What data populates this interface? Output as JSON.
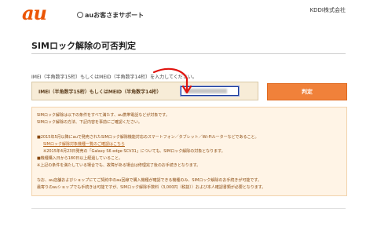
{
  "header": {
    "logo_text": "au",
    "support_label": "auお客さまサポート",
    "company": "KDDI株式会社"
  },
  "page_title": "SIMロック解除の可否判定",
  "form": {
    "hint": "IMEI（半角数字15桁）もしくはMEID（半角数字14桁）を入力してください。",
    "label": "IMEI（半角数字15桁）もしくはMEID（半角数字14桁）",
    "input_value": "",
    "submit_label": "判定"
  },
  "notice_lines": [
    "SIMロック解除は以下の条件をすべて満たす、au携帯電話などが対象です。",
    "SIMロック解除の方法、下記内容を事前にご確認ください。",
    "■2015年5月以降にauで発売されたSIMロック解除機能対応のスマートフォン／タブレット／Wi-Fiルーターなどであること。",
    "SIMロック解除対象機種一覧のご確認はこちら",
    "※2015年4月23日発売の「Galaxy S6 edge SCV31」についても、SIMロック解除の対象となります。",
    "■機種購入日から180日以上経過していること。",
    "※上記の条件を満たしている場合でも、故障がある場合は修理完了後のお手続きとなります。",
    "なお、au店舗およびショップにてご契約中のau回線で購入機種が確認できる機種のみ、SIMロック解除のお手続きが可能です。",
    "最寄りのauショップでも手続きは可能ですが、SIMロック解除手数料（3,000円（税抜））および本人確認書類が必要となります。"
  ],
  "colors": {
    "brand": "#eb5505",
    "button": "#f0813a",
    "annotation_arrow": "#e0140f"
  }
}
